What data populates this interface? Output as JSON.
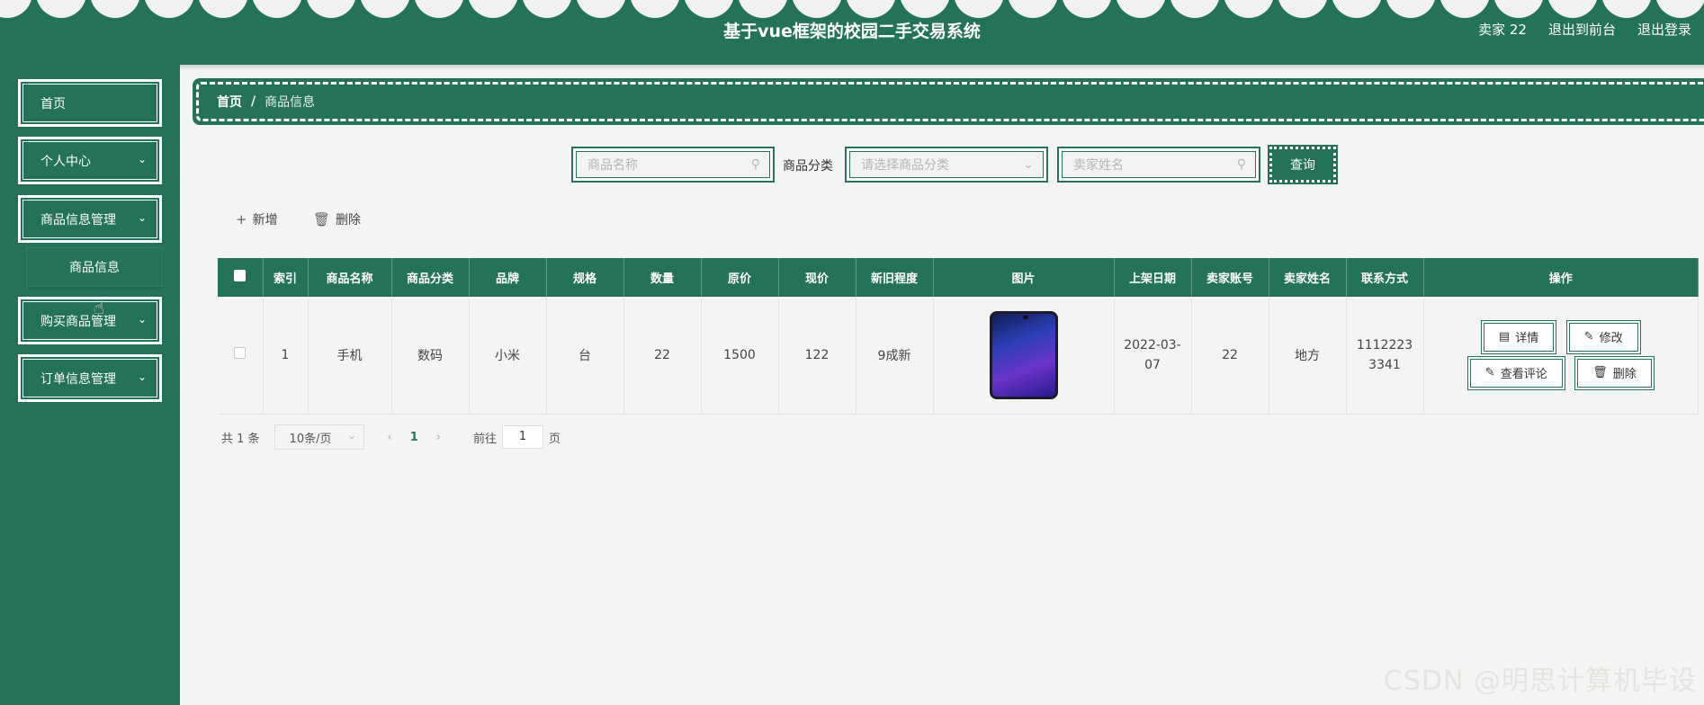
{
  "header": {
    "title": "基于vue框架的校园二手交易系统",
    "user": "卖家 22",
    "to_front": "退出到前台",
    "logout": "退出登录"
  },
  "sidebar": {
    "items": [
      {
        "label": "首页"
      },
      {
        "label": "个人中心"
      },
      {
        "label": "商品信息管理"
      },
      {
        "label": "购买商品管理"
      },
      {
        "label": "订单信息管理"
      }
    ],
    "sub_item": "商品信息"
  },
  "breadcrumb": {
    "home": "首页",
    "separator": "/",
    "current": "商品信息"
  },
  "search": {
    "name_placeholder": "商品名称",
    "category_label": "商品分类",
    "category_placeholder": "请选择商品分类",
    "seller_placeholder": "卖家姓名",
    "query_label": "查询"
  },
  "actions": {
    "add_label": "新增",
    "delete_label": "删除"
  },
  "table": {
    "columns": [
      "索引",
      "商品名称",
      "商品分类",
      "品牌",
      "规格",
      "数量",
      "原价",
      "现价",
      "新旧程度",
      "图片",
      "上架日期",
      "卖家账号",
      "卖家姓名",
      "联系方式",
      "操作"
    ],
    "rows": [
      {
        "index": "1",
        "name": "手机",
        "category": "数码",
        "brand": "小米",
        "spec": "台",
        "quantity": "22",
        "original_price": "1500",
        "current_price": "122",
        "condition": "9成新",
        "date_line1": "2022-03-",
        "date_line2": "07",
        "seller_account": "22",
        "seller_name": "地方",
        "contact_line1": "1112223",
        "contact_line2": "3341"
      }
    ],
    "ops": {
      "detail": "详情",
      "edit": "修改",
      "comments": "查看评论",
      "delete": "删除"
    }
  },
  "pagination": {
    "total": "共 1 条",
    "page_size": "10条/页",
    "current_page": "1",
    "goto_label": "前往",
    "goto_value": "1",
    "page_unit": "页"
  },
  "watermark": "CSDN @明思计算机毕设",
  "colors": {
    "primary": "#24725a",
    "background": "#f4f4f2"
  }
}
